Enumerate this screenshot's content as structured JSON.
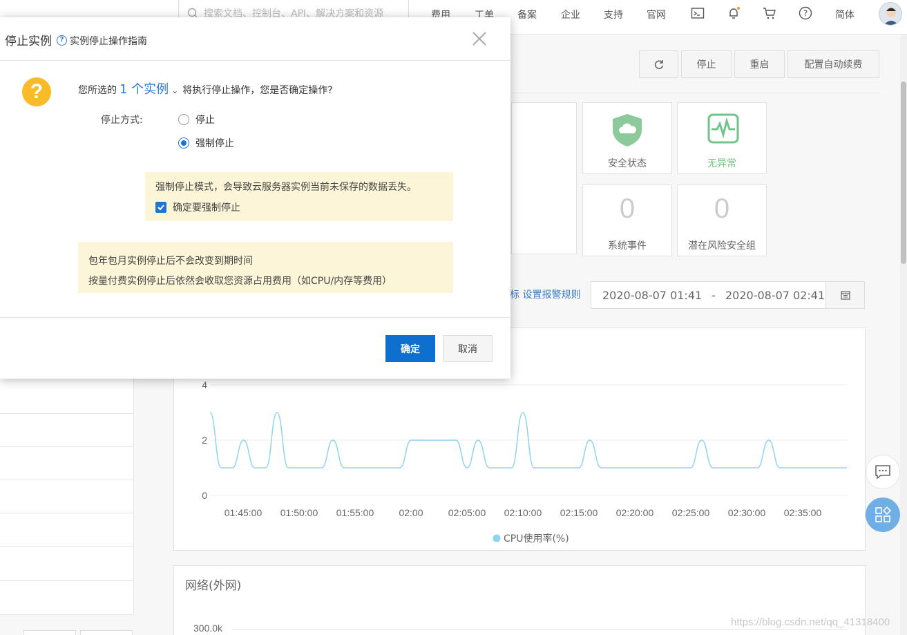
{
  "topnav": {
    "search_placeholder": "搜索文档、控制台、API、解决方案和资源",
    "links": [
      "费用",
      "工单",
      "备案",
      "企业",
      "支持",
      "官网"
    ],
    "lang": "简体",
    "icons": [
      "terminal-icon",
      "bell-icon",
      "cart-icon",
      "help-icon"
    ]
  },
  "toolbar": {
    "refresh_icon": "refresh-icon",
    "stop_label": "停止",
    "restart_label": "重启",
    "autorenew_label": "配置自动续费"
  },
  "status_cards": {
    "security_label": "安全状态",
    "health_label": "无异常",
    "events_value": "0",
    "events_label": "系统事件",
    "risk_value": "0",
    "risk_label": "潜在风险安全组"
  },
  "monitor": {
    "alarm_link": "标 设置报警规则",
    "start": "2020-08-07 01:41",
    "sep": "-",
    "end": "2020-08-07 02:41"
  },
  "chart_data": {
    "type": "line",
    "series": [
      {
        "name": "CPU使用率(%)",
        "color": "#8fd3f0"
      }
    ],
    "x_ticks": [
      "01:45:00",
      "01:50:00",
      "01:55:00",
      "02:00",
      "02:05:00",
      "02:10:00",
      "02:15:00",
      "02:20:00",
      "02:25:00",
      "02:30:00",
      "02:35:00"
    ],
    "y_ticks": [
      "0",
      "2",
      "4"
    ],
    "ylim": [
      0,
      4
    ],
    "x_minutes": [
      0,
      1,
      2,
      3,
      4,
      5,
      6,
      7,
      8,
      9,
      10,
      11,
      12,
      13,
      14,
      15,
      16,
      17,
      18,
      19,
      20,
      21,
      22,
      23,
      24,
      25,
      26,
      27,
      28,
      29,
      30,
      31,
      32,
      33,
      34,
      35,
      36,
      37,
      38,
      39,
      40,
      41,
      42,
      43,
      44,
      45,
      46,
      47,
      48,
      49,
      50,
      51,
      52,
      53,
      54,
      55,
      56,
      57
    ],
    "values": [
      3,
      1,
      1,
      2,
      1,
      1,
      3,
      1,
      1,
      1,
      1,
      2,
      1,
      1,
      1,
      1,
      1,
      1,
      2,
      2,
      2,
      2,
      2,
      1,
      2,
      1,
      1,
      1,
      3,
      1,
      1,
      1,
      1,
      1,
      2,
      1,
      1,
      1,
      1,
      1,
      1,
      1,
      1,
      1,
      2,
      1,
      1,
      1,
      1,
      1,
      2,
      1,
      1,
      1,
      1,
      1,
      1,
      1
    ]
  },
  "network": {
    "title": "网络(外网)",
    "tick": "300.0k"
  },
  "modal": {
    "title": "停止实例",
    "guide": "实例停止操作指南",
    "confirm_prefix": "您所选的",
    "confirm_count": "1 个实例",
    "confirm_suffix": "将执行停止操作，您是否确定操作?",
    "mode_label": "停止方式:",
    "option_stop": "停止",
    "option_force": "强制停止",
    "selected_option": "强制停止",
    "force_warning": "强制停止模式，会导致云服务器实例当前未保存的数据丢失。",
    "force_confirm": "确定要强制停止",
    "force_confirm_checked": true,
    "note1": "包年包月实例停止后不会改变到期时间",
    "note2": "按量付费实例停止后依然会收取您资源占用费用（如CPU/内存等费用）",
    "ok_label": "确定",
    "cancel_label": "取消"
  },
  "watermark": "https://blog.csdn.net/qq_41318400"
}
